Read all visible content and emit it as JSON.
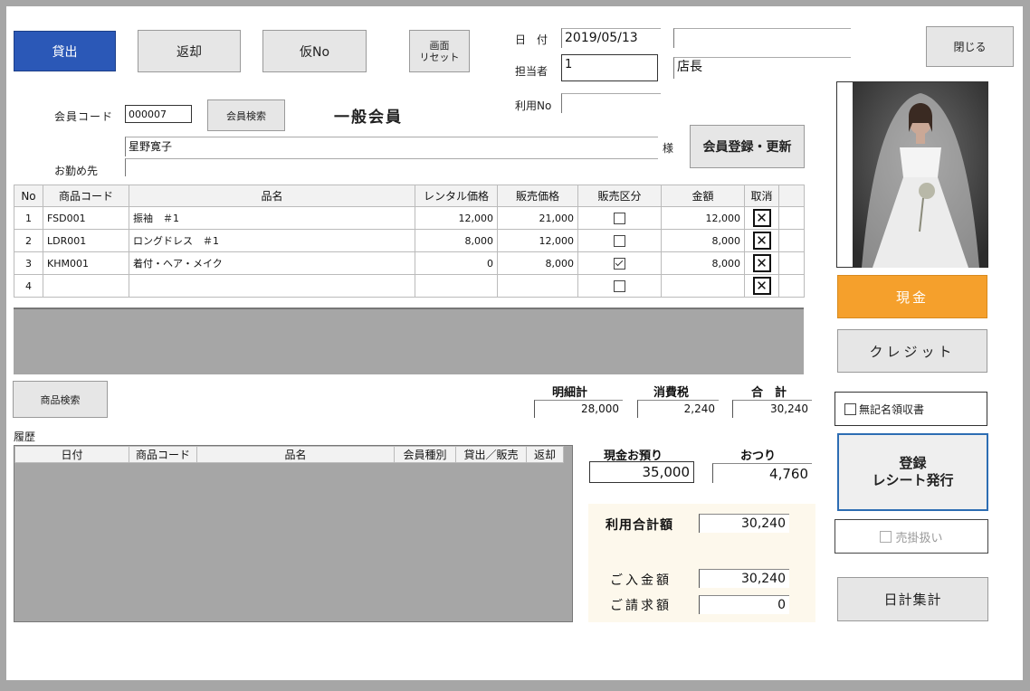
{
  "toolbar": {
    "lend": "貸出",
    "return": "返却",
    "provisional": "仮No",
    "reset": "画面\nリセット",
    "close": "閉じる"
  },
  "header": {
    "date_label": "日　付",
    "date_value": "2019/05/13",
    "staff_label": "担当者",
    "staff_value": "1",
    "staff_name": "店長",
    "use_no_label": "利用No",
    "use_no_value": ""
  },
  "member": {
    "code_label": "会員コード",
    "code_value": "000007",
    "search_button": "会員検索",
    "type": "一般会員",
    "name": "星野寛子",
    "honorific": "様",
    "workplace_label": "お勤め先",
    "workplace_value": "",
    "register_button": "会員登録・更新"
  },
  "items_table": {
    "headers": [
      "No",
      "商品コード",
      "品名",
      "レンタル価格",
      "販売価格",
      "販売区分",
      "金額",
      "取消"
    ],
    "rows": [
      {
        "no": "1",
        "code": "FSD001",
        "name": "振袖　＃1",
        "rental": "12,000",
        "sale": "21,000",
        "sale_flag": false,
        "amount": "12,000",
        "cancel": "✕"
      },
      {
        "no": "2",
        "code": "LDR001",
        "name": "ロングドレス　＃1",
        "rental": "8,000",
        "sale": "12,000",
        "sale_flag": false,
        "amount": "8,000",
        "cancel": "✕"
      },
      {
        "no": "3",
        "code": "KHM001",
        "name": "着付・ヘア・メイク",
        "rental": "0",
        "sale": "8,000",
        "sale_flag": true,
        "amount": "8,000",
        "cancel": "✕"
      },
      {
        "no": "4",
        "code": "",
        "name": "",
        "rental": "",
        "sale": "",
        "sale_flag": false,
        "amount": "",
        "cancel": "✕"
      }
    ]
  },
  "product_search_button": "商品検索",
  "totals": {
    "detail_label": "明細計",
    "detail_value": "28,000",
    "tax_label": "消費税",
    "tax_value": "2,240",
    "total_label": "合　計",
    "total_value": "30,240"
  },
  "history": {
    "title": "履歴",
    "headers": [
      "日付",
      "商品コード",
      "品名",
      "会員種別",
      "貸出／販売",
      "返却"
    ]
  },
  "payment": {
    "deposit_label": "現金お預り",
    "deposit_value": "35,000",
    "change_label": "おつり",
    "change_value": "4,760",
    "usage_total_label": "利用合計額",
    "usage_total_value": "30,240",
    "paid_label": "ご入金額",
    "paid_value": "30,240",
    "billed_label": "ご請求額",
    "billed_value": "0"
  },
  "side": {
    "cash": "現金",
    "credit": "クレジット",
    "anonymous_receipt": "無記名領収書",
    "register": "登録\nレシート発行",
    "credit_sale": "売掛扱い",
    "daily_total": "日計集計"
  }
}
